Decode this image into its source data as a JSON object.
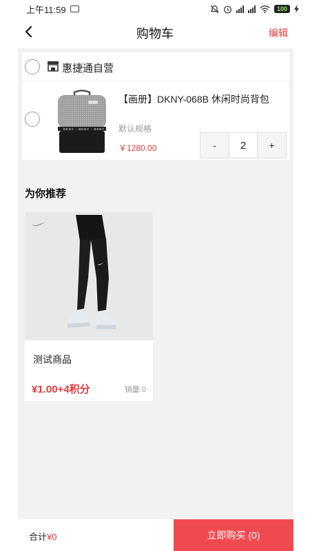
{
  "status_bar": {
    "time": "上午11:59",
    "battery": "100",
    "icons": [
      "message-icon",
      "mute-icon",
      "alarm-icon",
      "signal-icon",
      "signal-icon",
      "wifi-icon",
      "battery-icon",
      "charging-icon"
    ]
  },
  "nav": {
    "title": "购物车",
    "edit_label": "编辑",
    "back_icon": "back-arrow-icon"
  },
  "cart": {
    "store_name": "惠捷通自营",
    "store_icon": "store-icon",
    "items": [
      {
        "title": "【画册】DKNY-068B 休闲时尚背包",
        "spec": "默认规格",
        "price": "￥1280.00",
        "quantity": "2",
        "minus_label": "-",
        "plus_label": "+"
      }
    ]
  },
  "recommend": {
    "title": "为你推荐",
    "products": [
      {
        "name": "测试商品",
        "price": "¥1.00+4积分",
        "sales": "销量:0"
      }
    ]
  },
  "bottom": {
    "total_label": "合计",
    "total_value": "¥0",
    "buy_label": "立即购买 (0)"
  },
  "colors": {
    "accent": "#e4393c",
    "buy_button": "#f0494f",
    "background": "#f2f2f2"
  }
}
